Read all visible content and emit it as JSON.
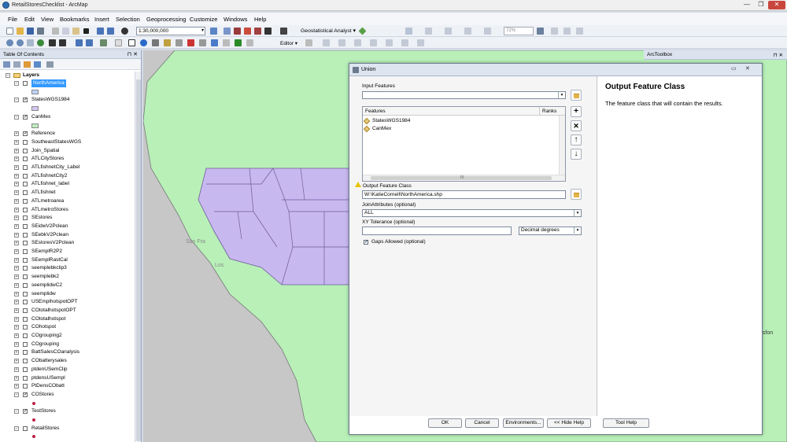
{
  "window": {
    "title": "RetailStoresChecklist - ArcMap",
    "min": "—",
    "max": "❐",
    "close": "✕"
  },
  "menu": [
    "File",
    "Edit",
    "View",
    "Bookmarks",
    "Insert",
    "Selection",
    "Geoprocessing",
    "Customize",
    "Windows",
    "Help"
  ],
  "toolbar": {
    "scale": "1:30,000,000",
    "geostat": "Geostatistical Analyst ▾",
    "editor": "Editor ▾",
    "zoom": "72%"
  },
  "toc": {
    "title": "Table Of Contents",
    "pins": "⊓ ✕",
    "root": "Layers",
    "layers": [
      {
        "name": "NorthAmerica",
        "checked": false,
        "selected": true
      },
      {
        "name": "StatesWGS1984",
        "checked": true
      },
      {
        "name": "CanMex",
        "checked": true
      },
      {
        "name": "Reference",
        "checked": true
      },
      {
        "name": "SoutheastStatesWGS",
        "checked": false
      },
      {
        "name": "Join_Spatial",
        "checked": false
      },
      {
        "name": "ATLCityStores",
        "checked": false
      },
      {
        "name": "ATLfishnetCity_Label",
        "checked": false
      },
      {
        "name": "ATLfishnetCity2",
        "checked": false
      },
      {
        "name": "ATLfishnet_label",
        "checked": false
      },
      {
        "name": "ATLfishnet",
        "checked": false
      },
      {
        "name": "ATLmetroarea",
        "checked": false
      },
      {
        "name": "ATLmetroStores",
        "checked": false
      },
      {
        "name": "SEstores",
        "checked": false
      },
      {
        "name": "SEidwV2Pclean",
        "checked": false
      },
      {
        "name": "SEebkV2Pclean",
        "checked": false
      },
      {
        "name": "SEstoresV2Pclean",
        "checked": false
      },
      {
        "name": "SEemplR2P2",
        "checked": false
      },
      {
        "name": "SEemplRastCal",
        "checked": false
      },
      {
        "name": "seemplebkclip3",
        "checked": false
      },
      {
        "name": "seemplebk2",
        "checked": false
      },
      {
        "name": "seemplidwC2",
        "checked": false
      },
      {
        "name": "seemplidw",
        "checked": false
      },
      {
        "name": "USEmplhotspotOPT",
        "checked": false
      },
      {
        "name": "COtotalhotspotOPT",
        "checked": false
      },
      {
        "name": "COtotalhotspot",
        "checked": false
      },
      {
        "name": "COhotspot",
        "checked": false
      },
      {
        "name": "COgrouping2",
        "checked": false
      },
      {
        "name": "COgrouping",
        "checked": false
      },
      {
        "name": "BattSalesCOanalysis",
        "checked": false
      },
      {
        "name": "CObatterysales",
        "checked": false
      },
      {
        "name": "ptdenUSemClip",
        "checked": false
      },
      {
        "name": "ptdensUSempl",
        "checked": false
      },
      {
        "name": "PtDensCObatt",
        "checked": false
      },
      {
        "name": "COStores",
        "checked": true
      },
      {
        "name": "TestStores",
        "checked": true
      },
      {
        "name": "RetailStores",
        "checked": false
      }
    ]
  },
  "map": {
    "labels": [
      "San Fra",
      "Los"
    ],
    "right_label": "nsfon"
  },
  "arctoolbox": {
    "title": "ArcToolbox",
    "pins": "⊓ ✕"
  },
  "dialog": {
    "title": "Union",
    "input_features_label": "Input Features",
    "grid_headers": [
      "Features",
      "Ranks"
    ],
    "features": [
      "StatesWGS1984",
      "CanMex"
    ],
    "scroll_mark": "III",
    "output_label": "Output Feature Class",
    "output_value": "W:\\KatieCornell\\NorthAmerica.shp",
    "join_label": "JoinAttributes (optional)",
    "join_value": "ALL",
    "xy_label": "XY Tolerance (optional)",
    "xy_value": "",
    "xy_unit": "Decimal degrees",
    "gaps_label": "Gaps Allowed (optional)",
    "gaps_checked": true,
    "help_title": "Output Feature Class",
    "help_text": "The feature class that will contain the results.",
    "buttons": [
      "OK",
      "Cancel",
      "Environments...",
      "<< Hide Help",
      "Tool Help"
    ],
    "side_buttons": [
      "+",
      "✕",
      "↑",
      "↓"
    ]
  },
  "colors": {
    "land": "#b8f0b8",
    "states": "#c8b8f0",
    "state_border": "#6e5a9a",
    "selected_layer": "#3399ff"
  }
}
